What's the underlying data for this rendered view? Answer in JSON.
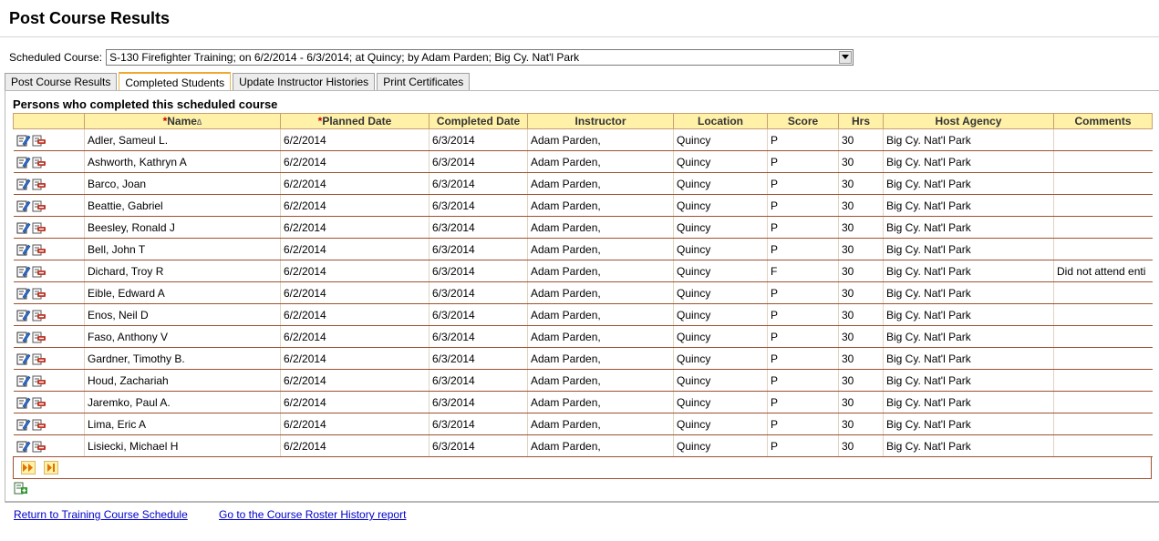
{
  "page": {
    "title": "Post Course Results"
  },
  "course": {
    "label": "Scheduled Course:",
    "selected": "S-130 Firefighter Training; on 6/2/2014 - 6/3/2014; at Quincy; by Adam Parden; Big Cy. Nat'l Park"
  },
  "tabs": [
    {
      "label": "Post Course Results",
      "active": false
    },
    {
      "label": "Completed Students",
      "active": true
    },
    {
      "label": "Update Instructor Histories",
      "active": false
    },
    {
      "label": "Print Certificates",
      "active": false
    }
  ],
  "section": {
    "heading": "Persons who completed this scheduled course"
  },
  "table": {
    "required_mark": "*",
    "sort_glyph": "∆",
    "headers": [
      "",
      "Name",
      "Planned Date",
      "Completed Date",
      "Instructor",
      "Location",
      "Score",
      "Hrs",
      "Host Agency",
      "Comments"
    ],
    "rows": [
      [
        "Adler, Sameul L.",
        "6/2/2014",
        "6/3/2014",
        "Adam Parden,",
        "Quincy",
        "P",
        "30",
        "Big Cy. Nat'l Park",
        ""
      ],
      [
        "Ashworth, Kathryn A",
        "6/2/2014",
        "6/3/2014",
        "Adam Parden,",
        "Quincy",
        "P",
        "30",
        "Big Cy. Nat'l Park",
        ""
      ],
      [
        "Barco, Joan",
        "6/2/2014",
        "6/3/2014",
        "Adam Parden,",
        "Quincy",
        "P",
        "30",
        "Big Cy. Nat'l Park",
        ""
      ],
      [
        "Beattie, Gabriel",
        "6/2/2014",
        "6/3/2014",
        "Adam Parden,",
        "Quincy",
        "P",
        "30",
        "Big Cy. Nat'l Park",
        ""
      ],
      [
        "Beesley, Ronald J",
        "6/2/2014",
        "6/3/2014",
        "Adam Parden,",
        "Quincy",
        "P",
        "30",
        "Big Cy. Nat'l Park",
        ""
      ],
      [
        "Bell, John T",
        "6/2/2014",
        "6/3/2014",
        "Adam Parden,",
        "Quincy",
        "P",
        "30",
        "Big Cy. Nat'l Park",
        ""
      ],
      [
        "Dichard, Troy R",
        "6/2/2014",
        "6/3/2014",
        "Adam Parden,",
        "Quincy",
        "F",
        "30",
        "Big Cy. Nat'l Park",
        "Did not attend enti"
      ],
      [
        "Eible, Edward A",
        "6/2/2014",
        "6/3/2014",
        "Adam Parden,",
        "Quincy",
        "P",
        "30",
        "Big Cy. Nat'l Park",
        ""
      ],
      [
        "Enos, Neil D",
        "6/2/2014",
        "6/3/2014",
        "Adam Parden,",
        "Quincy",
        "P",
        "30",
        "Big Cy. Nat'l Park",
        ""
      ],
      [
        "Faso, Anthony V",
        "6/2/2014",
        "6/3/2014",
        "Adam Parden,",
        "Quincy",
        "P",
        "30",
        "Big Cy. Nat'l Park",
        ""
      ],
      [
        "Gardner, Timothy B.",
        "6/2/2014",
        "6/3/2014",
        "Adam Parden,",
        "Quincy",
        "P",
        "30",
        "Big Cy. Nat'l Park",
        ""
      ],
      [
        "Houd, Zachariah",
        "6/2/2014",
        "6/3/2014",
        "Adam Parden,",
        "Quincy",
        "P",
        "30",
        "Big Cy. Nat'l Park",
        ""
      ],
      [
        "Jaremko, Paul A.",
        "6/2/2014",
        "6/3/2014",
        "Adam Parden,",
        "Quincy",
        "P",
        "30",
        "Big Cy. Nat'l Park",
        ""
      ],
      [
        "Lima, Eric A",
        "6/2/2014",
        "6/3/2014",
        "Adam Parden,",
        "Quincy",
        "P",
        "30",
        "Big Cy. Nat'l Park",
        ""
      ],
      [
        "Lisiecki, Michael H",
        "6/2/2014",
        "6/3/2014",
        "Adam Parden,",
        "Quincy",
        "P",
        "30",
        "Big Cy. Nat'l Park",
        ""
      ]
    ]
  },
  "footer": {
    "link_schedule": "Return to Training Course Schedule",
    "link_roster": "Go to the Course Roster History report"
  },
  "colors": {
    "header_bg": "#fff1a8",
    "row_border": "#a05030",
    "link": "#0000cc",
    "required": "#cc0000"
  },
  "icons": [
    "edit-icon",
    "delete-icon",
    "next-page-icon",
    "last-page-icon",
    "add-record-icon",
    "dropdown-arrow-icon"
  ]
}
